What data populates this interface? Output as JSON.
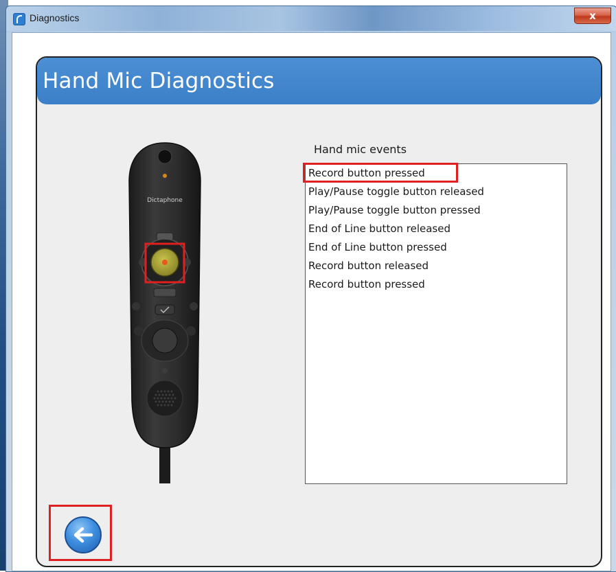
{
  "window": {
    "title": "Diagnostics",
    "close_label": "x"
  },
  "panel": {
    "title": "Hand Mic Diagnostics",
    "accent_color": "#3a7fc8"
  },
  "events": {
    "label": "Hand mic events",
    "items": [
      "Record button pressed",
      "Play/Pause toggle button released",
      "Play/Pause toggle button pressed",
      "End of Line button released",
      "End of Line button pressed",
      "Record button released",
      "Record button pressed"
    ],
    "highlighted_index": 0
  },
  "device": {
    "brand": "Dictaphone",
    "highlighted_button": "record-button"
  },
  "nav": {
    "back_icon": "arrow-left-icon"
  }
}
